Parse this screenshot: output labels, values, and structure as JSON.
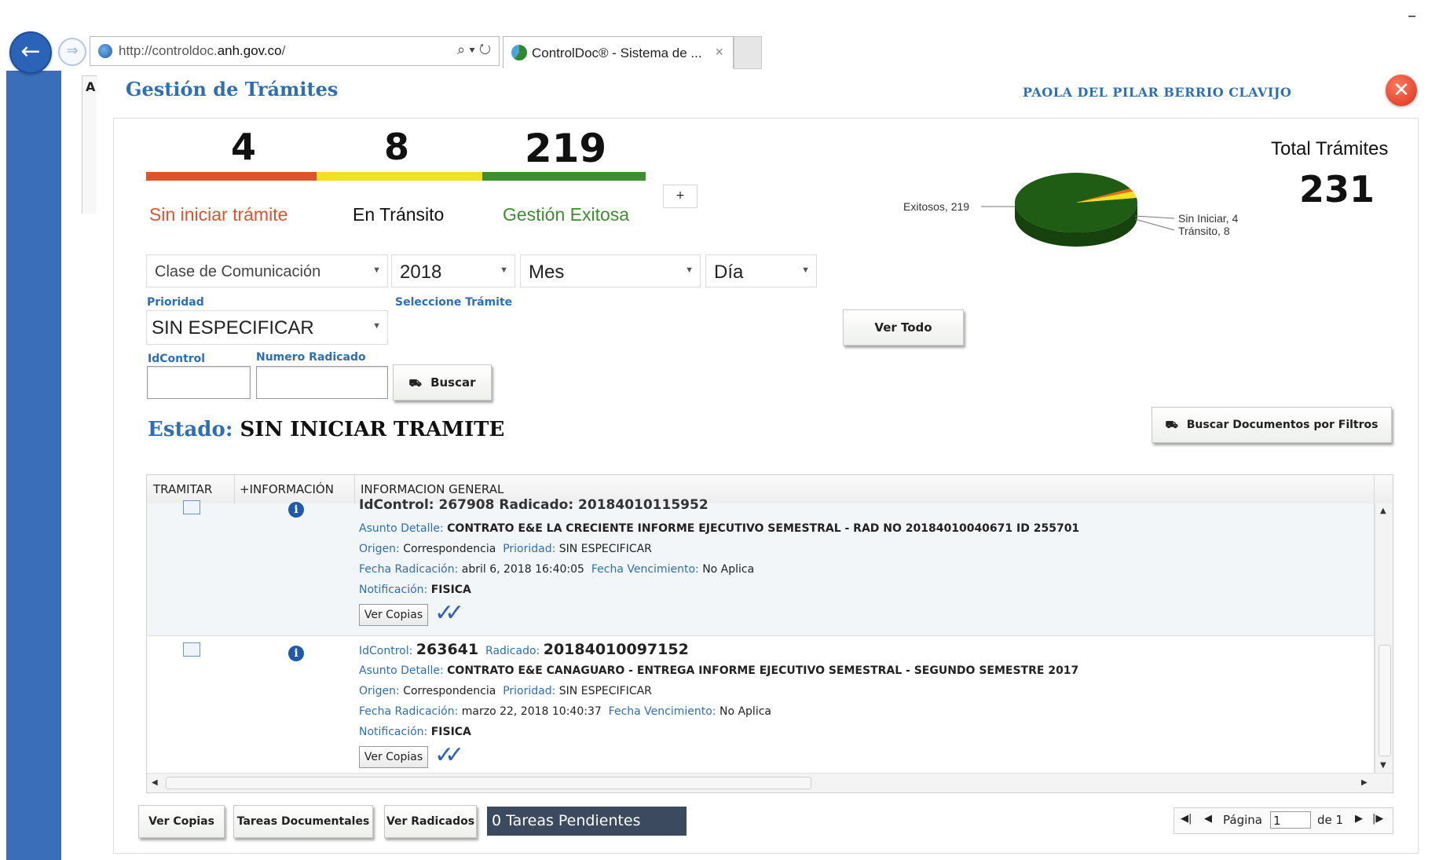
{
  "browser": {
    "url_prefix": "http://controldoc.",
    "url_domain": "anh.gov.co",
    "url_suffix": "/",
    "address_tools": "⌕ ▾ ↻",
    "tab_title": "ControlDoc® - Sistema de ...",
    "tab_close": "×",
    "minimize": "–"
  },
  "app": {
    "edge_letter": "A",
    "title": "Gestión de Trámites",
    "user": "PAOLA DEL PILAR BERRIO CLAVIJO",
    "close": "✕"
  },
  "summary": {
    "sin_iniciar": {
      "count": "4",
      "label": "Sin iniciar trámite",
      "color": "#e0522b"
    },
    "en_transito": {
      "count": "8",
      "label": "En Tránsito",
      "color": "#f2e11b"
    },
    "exitosa": {
      "count": "219",
      "label": "Gestión Exitosa",
      "color": "#3b8f2e"
    },
    "plus": "+",
    "total_label": "Total Trámites",
    "total_value": "231"
  },
  "chart_data": {
    "type": "pie",
    "slices": [
      {
        "label": "Exitosos",
        "value": 219,
        "color": "#1f5d14"
      },
      {
        "label": "Sin Iniciar",
        "value": 4,
        "color": "#e36c1a"
      },
      {
        "label": "Tránsito",
        "value": 8,
        "color": "#f2e11b"
      }
    ],
    "labels": {
      "exitosos": "Exitosos, 219",
      "sin_iniciar": "Sin Iniciar, 4",
      "transito": "Tránsito, 8"
    }
  },
  "filters": {
    "clase": "Clase de Comunicación",
    "year": "2018",
    "mes": "Mes",
    "dia": "Día",
    "prioridad_label": "Prioridad",
    "prioridad_value": "SIN ESPECIFICAR",
    "seleccione_tramite": "Seleccione Trámite",
    "idcontrol_label": "IdControl",
    "radicado_label": "Numero Radicado",
    "buscar": "Buscar",
    "ver_todo": "Ver Todo",
    "buscar_filtros": "Buscar Documentos por Filtros"
  },
  "estado": {
    "key": "Estado:",
    "value": "SIN INICIAR TRAMITE"
  },
  "table": {
    "headers": {
      "tramitar": "TRAMITAR",
      "info": "+INFORMACIÓN",
      "general": "INFORMACION GENERAL"
    },
    "row1": {
      "partial_line": "IdControl: 267908  Radicado: 20184010115952",
      "asunto_k": "Asunto Detalle:",
      "asunto_v": "CONTRATO E&E LA CRECIENTE INFORME EJECUTIVO SEMESTRAL - RAD NO 20184010040671 ID 255701",
      "origen_k": "Origen:",
      "origen_v": "Correspondencia",
      "prioridad_k": "Prioridad:",
      "prioridad_v": "SIN ESPECIFICAR",
      "fecha_k": "Fecha Radicación:",
      "fecha_v": "abril 6, 2018 16:40:05",
      "venc_k": "Fecha Vencimiento:",
      "venc_v": "No Aplica",
      "notif_k": "Notificación:",
      "notif_v": "FISICA",
      "ver_copias": "Ver Copias"
    },
    "row2": {
      "id_k": "IdControl:",
      "id_v": "263641",
      "rad_k": "Radicado:",
      "rad_v": "20184010097152",
      "asunto_k": "Asunto Detalle:",
      "asunto_v": "CONTRATO E&E CANAGUARO - ENTREGA INFORME EJECUTIVO SEMESTRAL - SEGUNDO SEMESTRE 2017",
      "origen_k": "Origen:",
      "origen_v": "Correspondencia",
      "prioridad_k": "Prioridad:",
      "prioridad_v": "SIN ESPECIFICAR",
      "fecha_k": "Fecha Radicación:",
      "fecha_v": "marzo 22, 2018 10:40:37",
      "venc_k": "Fecha Vencimiento:",
      "venc_v": "No Aplica",
      "notif_k": "Notificación:",
      "notif_v": "FISICA",
      "ver_copias": "Ver Copias"
    },
    "info_glyph": "i"
  },
  "footer": {
    "ver_copias": "Ver Copias",
    "tareas_documentales": "Tareas Documentales",
    "ver_radicados": "Ver Radicados",
    "tareas_pendientes": "0 Tareas Pendientes",
    "pagina_label": "Página",
    "pagina_value": "1",
    "de_label": "de 1"
  }
}
